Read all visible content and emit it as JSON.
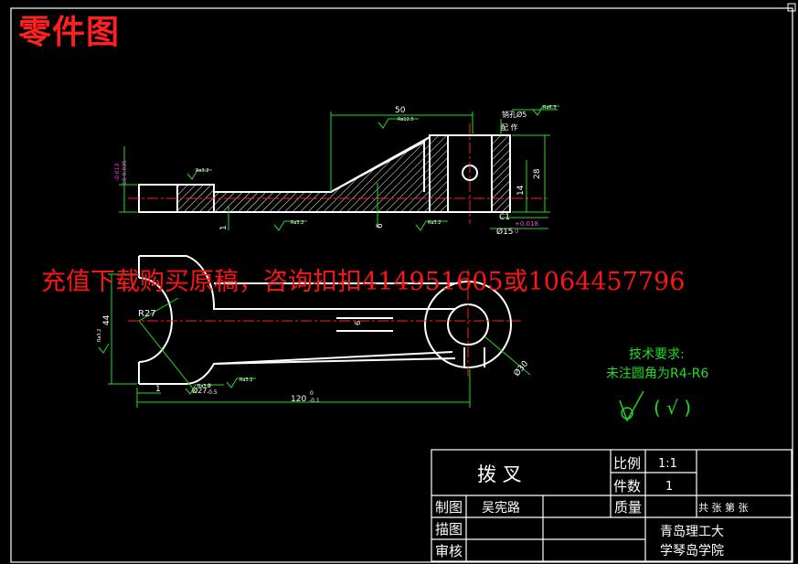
{
  "title": "零件图",
  "ad_banner": "充值下载购买原稿，咨询扣扣414951605或1064457796",
  "tech_requirements": {
    "heading": "技术要求:",
    "line1": "未注圆角为R4-R6"
  },
  "roughness_note": "( √ )",
  "dimensions": {
    "d50": "50",
    "d28": "28",
    "d14": "14",
    "d6": "6",
    "d1_front": "1",
    "d1_top": "1",
    "phi15": "Ø15",
    "phi15_tol": "+0.018",
    "phi15_tol_lower": "0",
    "c1": "C1",
    "pin_hole": "销孔Ø5",
    "pin_hole_note": "配 作",
    "d10_upper": "-0.013",
    "d10_lower": "10-0.035",
    "r27": "R27",
    "d44": "44",
    "phi30": "Ø30",
    "d120": "120",
    "d120_tol": "-0.1",
    "d120_tol_upper": "0",
    "d6_top": "6",
    "phi27": "Ø27",
    "phi27_tol": "-0.5",
    "phi27_tol_upper": "0",
    "ra_a": "Ra3.2",
    "ra_b": "Ra12.5",
    "ra_c": "Ra3.2",
    "ra_d": "Ra3.2",
    "ra_e": "Ra6.3",
    "ra_f": "Ra3.2",
    "ra_g": "Ra3.2",
    "ra_h": "Ra3.2"
  },
  "title_block": {
    "part_name": "拨   叉",
    "scale_label": "比例",
    "scale_value": "1:1",
    "qty_label": "件数",
    "qty_value": "1",
    "drawn_label": "制图",
    "drawn_by": "吴宪路",
    "mass_label": "质量",
    "sheet_text": "共 张 第 张",
    "trace_label": "描图",
    "review_label": "审核",
    "school_line1": "青岛理工大",
    "school_line2": "学琴岛学院"
  },
  "colors": {
    "background": "#000000",
    "outline": "#ffffff",
    "dimension": "#22dd22",
    "text_dim": "#ffffff",
    "center_line": "#ff2222",
    "tolerance": "#ff44ff",
    "title_red": "#ff2020"
  }
}
